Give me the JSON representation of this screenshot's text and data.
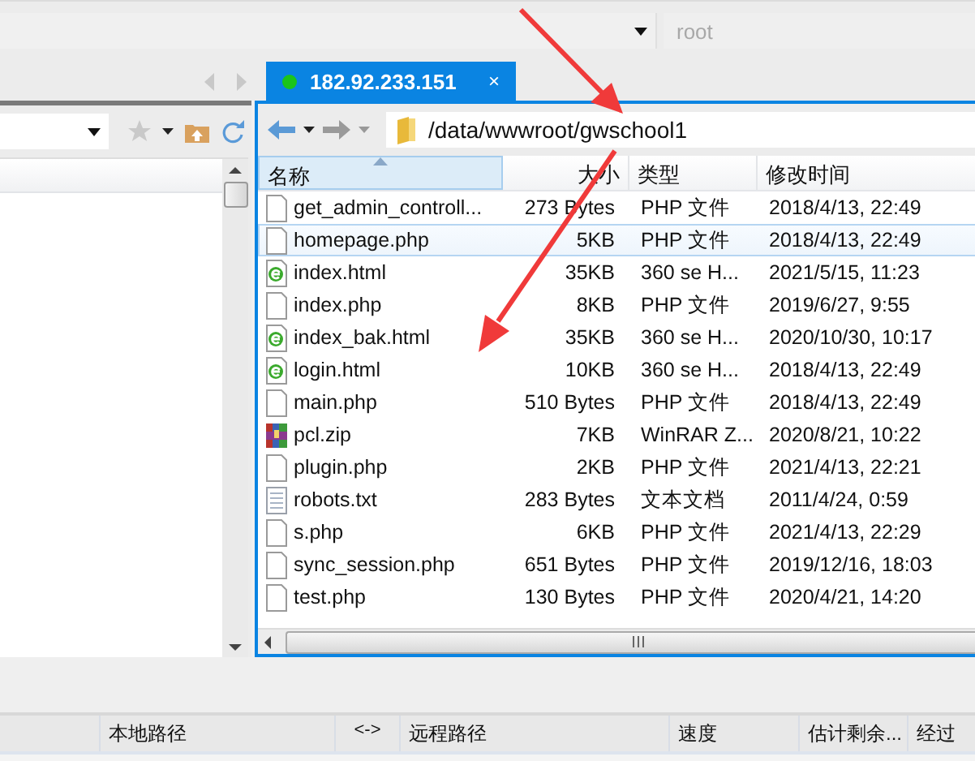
{
  "top_bar": {
    "user_field": {
      "placeholder": "root"
    }
  },
  "tabs": [
    {
      "label": "182.92.233.151",
      "selected": true,
      "connected": true,
      "close": "×"
    }
  ],
  "remote_panel": {
    "path": "/data/wwwroot/gwschool1",
    "columns": [
      {
        "label": "名称",
        "sorted": true
      },
      {
        "label": "大小",
        "sorted": false
      },
      {
        "label": "类型",
        "sorted": false
      },
      {
        "label": "修改时间",
        "sorted": false
      }
    ],
    "rows": [
      {
        "kind": "file",
        "name": "get_admin_controll...",
        "size": "273 Bytes",
        "type": "PHP 文件",
        "modified": "2018/4/13, 22:49",
        "selected": false
      },
      {
        "kind": "file",
        "name": "homepage.php",
        "size": "5KB",
        "type": "PHP 文件",
        "modified": "2018/4/13, 22:49",
        "selected": true
      },
      {
        "kind": "html",
        "name": "index.html",
        "size": "35KB",
        "type": "360 se H...",
        "modified": "2021/5/15, 11:23",
        "selected": false
      },
      {
        "kind": "file",
        "name": "index.php",
        "size": "8KB",
        "type": "PHP 文件",
        "modified": "2019/6/27, 9:55",
        "selected": false
      },
      {
        "kind": "html",
        "name": "index_bak.html",
        "size": "35KB",
        "type": "360 se H...",
        "modified": "2020/10/30, 10:17",
        "selected": false
      },
      {
        "kind": "html",
        "name": "login.html",
        "size": "10KB",
        "type": "360 se H...",
        "modified": "2018/4/13, 22:49",
        "selected": false
      },
      {
        "kind": "file",
        "name": "main.php",
        "size": "510 Bytes",
        "type": "PHP 文件",
        "modified": "2018/4/13, 22:49",
        "selected": false
      },
      {
        "kind": "zip",
        "name": "pcl.zip",
        "size": "7KB",
        "type": "WinRAR Z...",
        "modified": "2020/8/21, 10:22",
        "selected": false
      },
      {
        "kind": "file",
        "name": "plugin.php",
        "size": "2KB",
        "type": "PHP 文件",
        "modified": "2021/4/13, 22:21",
        "selected": false
      },
      {
        "kind": "text",
        "name": "robots.txt",
        "size": "283 Bytes",
        "type": "文本文档",
        "modified": "2011/4/24, 0:59",
        "selected": false
      },
      {
        "kind": "file",
        "name": "s.php",
        "size": "6KB",
        "type": "PHP 文件",
        "modified": "2021/4/13, 22:29",
        "selected": false
      },
      {
        "kind": "file",
        "name": "sync_session.php",
        "size": "651 Bytes",
        "type": "PHP 文件",
        "modified": "2019/12/16, 18:03",
        "selected": false
      },
      {
        "kind": "file",
        "name": "test.php",
        "size": "130 Bytes",
        "type": "PHP 文件",
        "modified": "2020/4/21, 14:20",
        "selected": false
      }
    ]
  },
  "transfer_queue": {
    "columns": [
      "本地路径",
      "<->",
      "远程路径",
      "速度",
      "估计剩余...",
      "经过"
    ]
  }
}
